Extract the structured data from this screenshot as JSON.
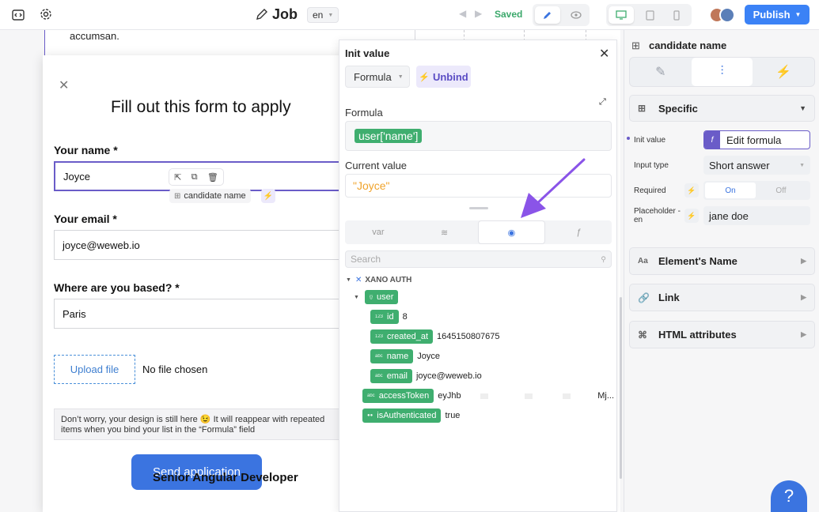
{
  "topbar": {
    "page_name": "Job",
    "language": "en",
    "save_status": "Saved",
    "publish_label": "Publish"
  },
  "canvas": {
    "background_text": "accumsan.",
    "form": {
      "title": "Fill out this form to apply",
      "name_label": "Your name *",
      "name_value": "Joyce",
      "email_label": "Your email *",
      "email_value": "joyce@weweb.io",
      "location_label": "Where are you based? *",
      "location_value": "Paris",
      "upload_label": "Upload file",
      "no_file": "No file chosen",
      "note": "Don’t worry, your design is still here 😉 It will reappear with repeated items when you bind your list in the “Formula” field",
      "submit_label": "Send application"
    },
    "below_form_title": "Senior Angular Developer",
    "selected_element_name": "candidate name"
  },
  "popup": {
    "title": "Init value",
    "mode_select": "Formula",
    "unbind_label": "Unbind",
    "formula_label": "Formula",
    "formula_value": "user['name']",
    "current_label": "Current value",
    "current_value": "\"Joyce\"",
    "tabs": [
      "var",
      "db",
      "user",
      "f"
    ],
    "search_placeholder": "Search",
    "tree": {
      "group": "XANO AUTH",
      "root": "user",
      "fields": [
        {
          "type": "123",
          "key": "id",
          "value": "8"
        },
        {
          "type": "123",
          "key": "created_at",
          "value": "1645150807675"
        },
        {
          "type": "abc",
          "key": "name",
          "value": "Joyce"
        },
        {
          "type": "abc",
          "key": "email",
          "value": "joyce@weweb.io"
        }
      ],
      "access_token": {
        "type": "abc",
        "key": "accessToken",
        "value": "eyJhb",
        "value_end": "Mj..."
      },
      "is_authenticated": {
        "key": "isAuthenticated",
        "value": "true"
      }
    }
  },
  "right_panel": {
    "element_name": "candidate name",
    "specific_label": "Specific",
    "props": {
      "init_value_label": "Init value",
      "init_value_button": "Edit formula",
      "input_type_label": "Input type",
      "input_type_value": "Short answer",
      "required_label": "Required",
      "required_on": "On",
      "required_off": "Off",
      "placeholder_label": "Placeholder - en",
      "placeholder_value": "jane doe"
    },
    "sections": [
      "Element's Name",
      "Link",
      "HTML attributes"
    ]
  },
  "help_label": "?",
  "colors": {
    "accent": "#3b74e0",
    "bind_purple": "#6a5cc8",
    "variable_green": "#3fae6f",
    "current_value_orange": "#f0a32b"
  }
}
